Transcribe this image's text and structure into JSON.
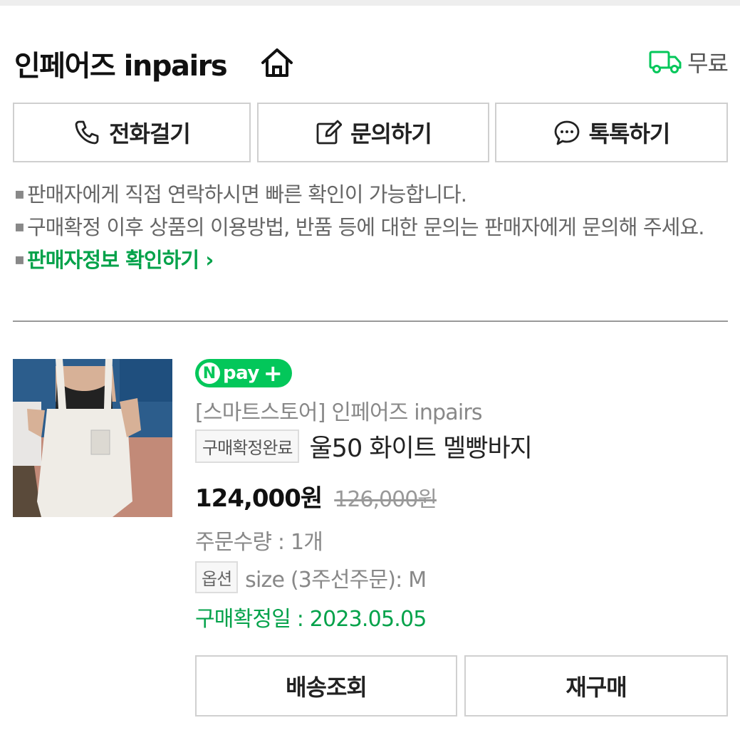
{
  "store": {
    "name": "인페어즈 inpairs",
    "delivery_label": "무료"
  },
  "actions": [
    {
      "label": "전화걸기",
      "icon": "phone-icon"
    },
    {
      "label": "문의하기",
      "icon": "edit-icon"
    },
    {
      "label": "톡톡하기",
      "icon": "chat-icon"
    }
  ],
  "notes": [
    "판매자에게 직접 연락하시면 빠른 확인이 가능합니다.",
    "구매확정 이후 상품의 이용방법, 반품 등에 대한 문의는 판매자에게 문의해 주세요.",
    "판매자정보 확인하기"
  ],
  "order": {
    "badge_text": "pay",
    "badge_n": "N",
    "seller": "[스마트스토어] 인페어즈 inpairs",
    "status": "구매확정완료",
    "title": "울50 화이트 멜빵바지",
    "price": "124,000원",
    "original_price": "126,000원",
    "quantity": "주문수량 : 1개",
    "option_label": "옵션",
    "option_value": "size (3주선주문): M",
    "confirm_date": "구매확정일 : 2023.05.05"
  },
  "buttons": {
    "track": "배송조회",
    "rebuy": "재구매"
  },
  "colors": {
    "accent_green": "#03c75a",
    "link_green": "#03a24a"
  }
}
